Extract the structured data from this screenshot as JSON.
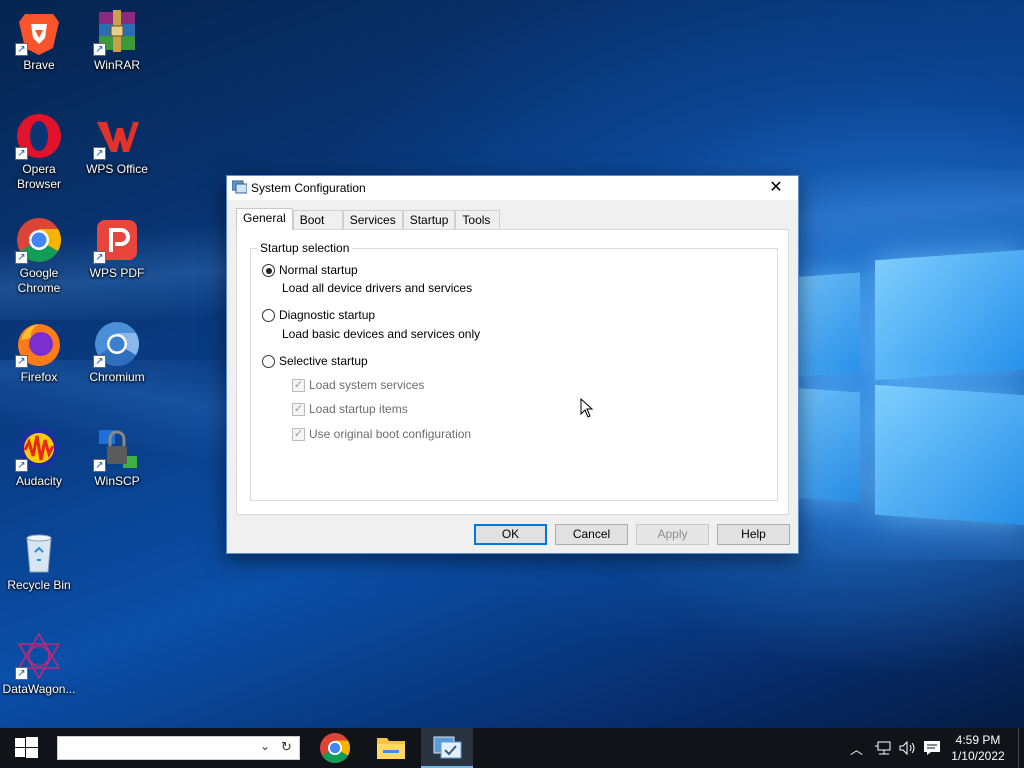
{
  "desktop": {
    "icons": [
      {
        "label": "Brave"
      },
      {
        "label": "WinRAR"
      },
      {
        "label": "Opera Browser"
      },
      {
        "label": "WPS Office"
      },
      {
        "label": "Google Chrome"
      },
      {
        "label": "WPS PDF"
      },
      {
        "label": "Firefox"
      },
      {
        "label": "Chromium"
      },
      {
        "label": "Audacity"
      },
      {
        "label": "WinSCP"
      },
      {
        "label": "Recycle Bin"
      },
      {
        "label": "DataWagon..."
      }
    ]
  },
  "dialog": {
    "title": "System Configuration",
    "close_glyph": "✕",
    "tabs": [
      {
        "label": "General",
        "active": true
      },
      {
        "label": "Boot"
      },
      {
        "label": "Services"
      },
      {
        "label": "Startup"
      },
      {
        "label": "Tools"
      }
    ],
    "group_title": "Startup selection",
    "options": {
      "normal": {
        "label": "Normal startup",
        "desc": "Load all device drivers and services",
        "selected": true
      },
      "diagnostic": {
        "label": "Diagnostic startup",
        "desc": "Load basic devices and services only",
        "selected": false
      },
      "selective": {
        "label": "Selective startup",
        "selected": false
      }
    },
    "checks": [
      {
        "label": "Load system services",
        "checked": true,
        "enabled": false
      },
      {
        "label": "Load startup items",
        "checked": true,
        "enabled": false
      },
      {
        "label": "Use original boot configuration",
        "checked": true,
        "enabled": false
      }
    ],
    "buttons": {
      "ok": "OK",
      "cancel": "Cancel",
      "apply": "Apply",
      "help": "Help"
    }
  },
  "taskbar": {
    "search_value": "",
    "pinned": [
      "chrome-icon",
      "file-explorer-icon",
      "system-configuration-icon"
    ],
    "clock": {
      "time": "4:59 PM",
      "date": "1/10/2022"
    }
  },
  "colors": {
    "accent": "#0078d7",
    "taskbar": "#101318",
    "dialog_bg": "#f0f0f0"
  }
}
